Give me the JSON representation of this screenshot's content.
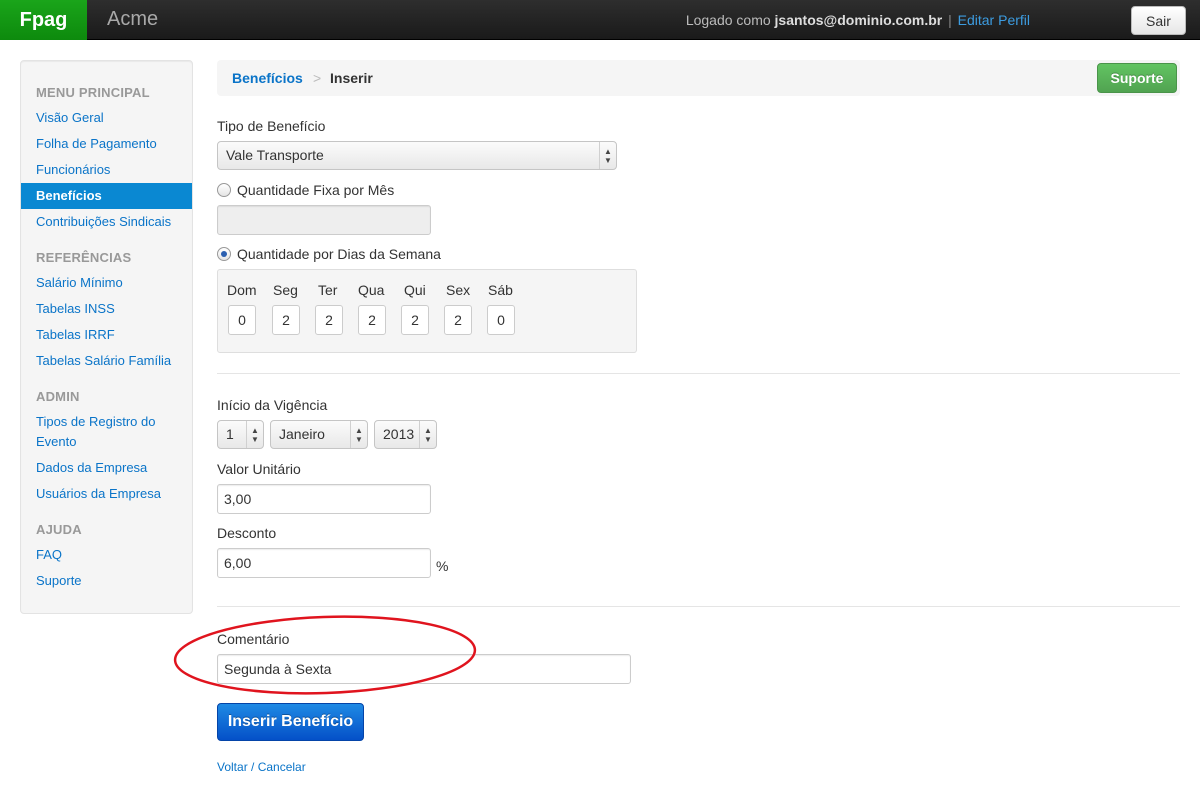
{
  "app": {
    "brand": "Fpag",
    "company": "Acme",
    "user_prefix": "Logado como",
    "user_email": "jsantos@dominio.com.br",
    "separator": "|",
    "edit_profile": "Editar Perfil",
    "logout": "Sair"
  },
  "sidebar": {
    "sections": [
      {
        "header": "MENU PRINCIPAL",
        "items": [
          "Visão Geral",
          "Folha de Pagamento",
          "Funcionários",
          "Benefícios",
          "Contribuições Sindicais"
        ]
      },
      {
        "header": "REFERÊNCIAS",
        "items": [
          "Salário Mínimo",
          "Tabelas INSS",
          "Tabelas IRRF",
          "Tabelas Salário Família"
        ]
      },
      {
        "header": "ADMIN",
        "items": [
          "Tipos de Registro do Evento",
          "Dados da Empresa",
          "Usuários da Empresa"
        ]
      },
      {
        "header": "AJUDA",
        "items": [
          "FAQ",
          "Suporte"
        ]
      }
    ],
    "active": "Benefícios"
  },
  "breadcrumb": {
    "parent": "Benefícios",
    "divider": ">",
    "current": "Inserir",
    "support": "Suporte"
  },
  "form": {
    "benefit_type_label": "Tipo de Benefício",
    "benefit_type_value": "Vale Transporte",
    "fixed_qty_label": "Quantidade Fixa por Mês",
    "fixed_qty_value": "",
    "weekday_qty_label": "Quantidade por Dias da Semana",
    "days": [
      {
        "label": "Dom",
        "value": "0"
      },
      {
        "label": "Seg",
        "value": "2"
      },
      {
        "label": "Ter",
        "value": "2"
      },
      {
        "label": "Qua",
        "value": "2"
      },
      {
        "label": "Qui",
        "value": "2"
      },
      {
        "label": "Sex",
        "value": "2"
      },
      {
        "label": "Sáb",
        "value": "0"
      }
    ],
    "start_label": "Início da Vigência",
    "start_day": "1",
    "start_month": "Janeiro",
    "start_year": "2013",
    "unit_value_label": "Valor Unitário",
    "unit_value": "3,00",
    "discount_label": "Desconto",
    "discount_value": "6,00",
    "discount_unit": "%",
    "comment_label": "Comentário",
    "comment_value": "Segunda à Sexta",
    "submit": "Inserir Benefício",
    "cancel": "Voltar / Cancelar"
  },
  "colors": {
    "brand_green": "#0d8a0d",
    "link_blue": "#0a74c8",
    "active_nav": "#0a88d2",
    "primary_button": "#0450c8",
    "support_button": "#51a351",
    "annotation_red": "#e0141e"
  }
}
